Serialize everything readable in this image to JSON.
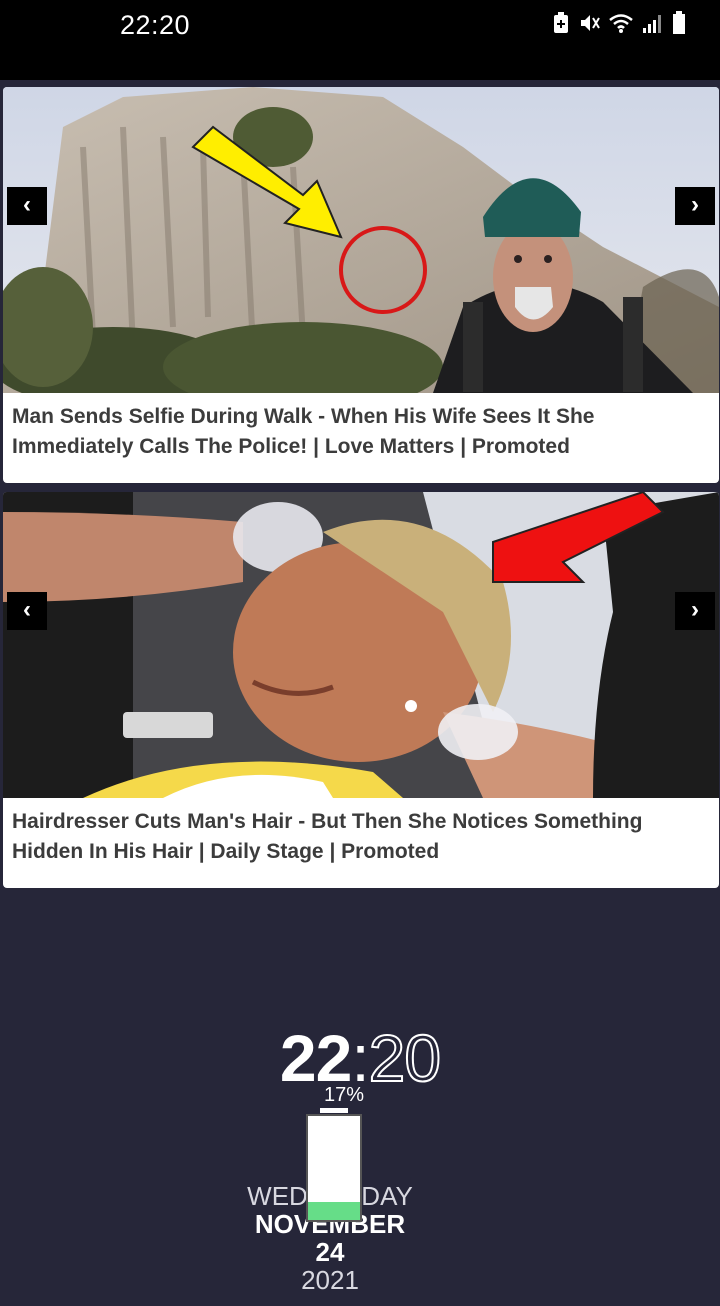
{
  "status_bar": {
    "time": "22:20"
  },
  "feed": {
    "cards": [
      {
        "title": "Man Sends Selfie During Walk - When His Wife Sees It She Immediately Calls The Police! | Love Matters | Promoted",
        "prev_label": "‹",
        "next_label": "›"
      },
      {
        "title": "Hairdresser Cuts Man's Hair - But Then She Notices Something Hidden In His Hair | Daily Stage | Promoted",
        "prev_label": "‹",
        "next_label": "›"
      }
    ]
  },
  "lock_screen": {
    "hours": "22",
    "separator": ":",
    "minutes": "20",
    "battery_percent": "17%",
    "battery_level": 0.17,
    "weekday": "WEDNESDAY",
    "month": "NOVEMBER",
    "day": "24",
    "year": "2021"
  },
  "colors": {
    "background": "#262639",
    "status_bar": "#000000",
    "battery_fill": "#66dd88"
  }
}
